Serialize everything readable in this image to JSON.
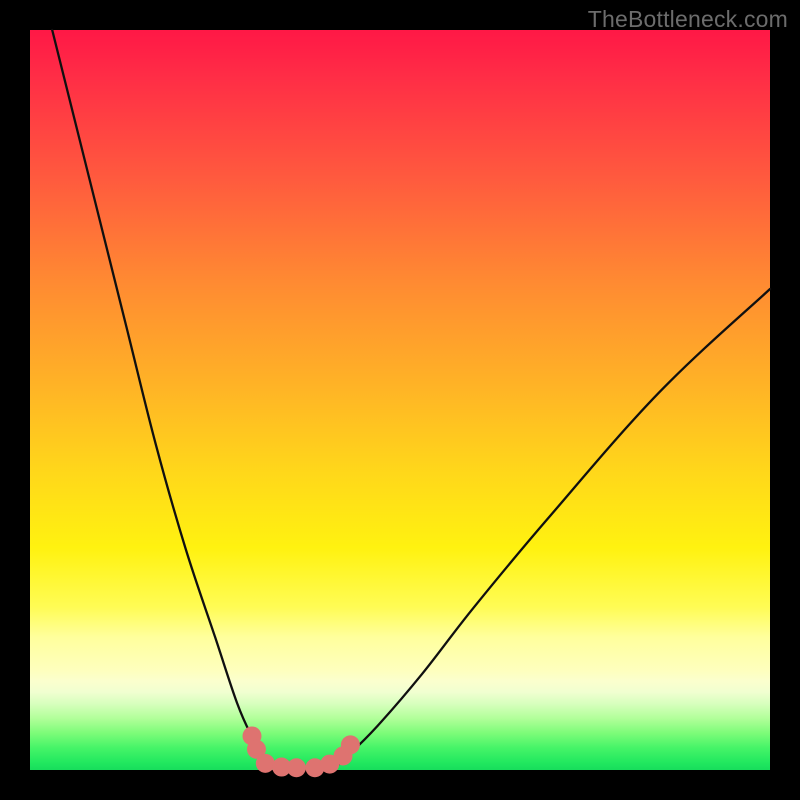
{
  "watermark": "TheBottleneck.com",
  "domain": "Chart",
  "colors": {
    "background_outer": "#000000",
    "gradient_top": "#ff1846",
    "gradient_mid": "#fff210",
    "gradient_bottom": "#17dd5c",
    "curve_stroke": "#101010",
    "marker_fill": "#de7370",
    "watermark": "#6c6c6c"
  },
  "chart_data": {
    "type": "line",
    "title": "",
    "xlabel": "",
    "ylabel": "",
    "xlim": [
      0,
      100
    ],
    "ylim": [
      0,
      100
    ],
    "series": [
      {
        "name": "left-curve",
        "x": [
          3,
          8,
          13,
          17,
          21,
          25,
          28,
          30,
          31.5,
          34.5,
          38
        ],
        "values": [
          100,
          80,
          60,
          44,
          30,
          18,
          9,
          4.5,
          2,
          0,
          0
        ]
      },
      {
        "name": "right-curve",
        "x": [
          38,
          40.5,
          43,
          47,
          53,
          60,
          70,
          85,
          100
        ],
        "values": [
          0,
          0,
          2,
          6,
          13,
          22,
          34,
          51,
          65
        ]
      }
    ],
    "x_start_left": 3,
    "x_start_right": 100,
    "vertex_x": 36,
    "vertex_y": 0,
    "markers": [
      {
        "x": 30.0,
        "y": 4.6
      },
      {
        "x": 30.6,
        "y": 2.8
      },
      {
        "x": 31.8,
        "y": 0.9
      },
      {
        "x": 34.0,
        "y": 0.4
      },
      {
        "x": 36.0,
        "y": 0.3
      },
      {
        "x": 38.5,
        "y": 0.3
      },
      {
        "x": 40.5,
        "y": 0.8
      },
      {
        "x": 42.3,
        "y": 1.9
      },
      {
        "x": 43.3,
        "y": 3.4
      }
    ]
  }
}
